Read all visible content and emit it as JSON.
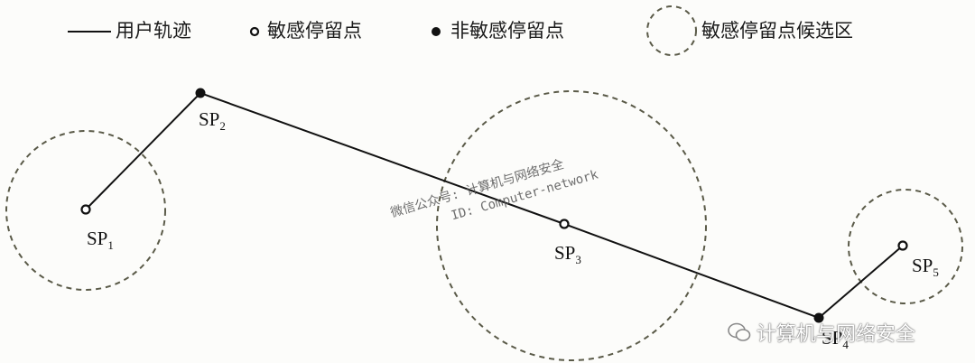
{
  "legend": {
    "trajectory": "用户轨迹",
    "sensitive_stop": "敏感停留点",
    "non_sensitive_stop": "非敏感停留点",
    "sensitive_candidate_region": "敏感停留点候选区"
  },
  "points": [
    {
      "id": "SP",
      "sub": "1",
      "type": "sensitive"
    },
    {
      "id": "SP",
      "sub": "2",
      "type": "non-sensitive"
    },
    {
      "id": "SP",
      "sub": "3",
      "type": "sensitive"
    },
    {
      "id": "SP",
      "sub": "4",
      "type": "non-sensitive"
    },
    {
      "id": "SP",
      "sub": "5",
      "type": "sensitive"
    }
  ],
  "watermark": {
    "line1": "微信公众号: 计算机与网络安全",
    "line2": "ID: Computer-network",
    "brand": "计算机与网络安全",
    "brand_icon": "wechat-icon"
  },
  "colors": {
    "line": "#111111",
    "region": "#5a5a48",
    "background": "#fcfcfa"
  }
}
